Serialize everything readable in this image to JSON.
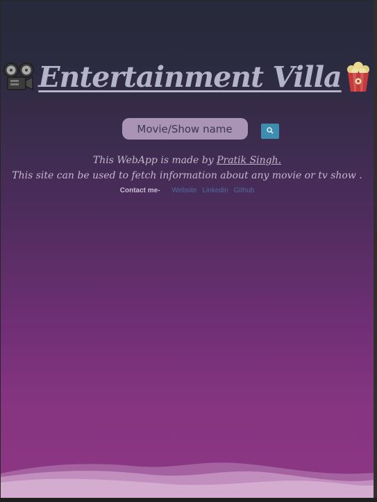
{
  "header": {
    "title": "Entertainment Villa",
    "left_icon": "film-projector-icon",
    "right_icon": "popcorn-icon"
  },
  "search": {
    "placeholder": "Movie/Show name",
    "button_icon": "search-icon"
  },
  "credit": {
    "prefix": "This WebApp is made by ",
    "author": "Pratik Singh.",
    "line2": "This site can be used to fetch information about any movie or tv show ."
  },
  "contact": {
    "label": "Contact me-",
    "links": [
      "Website",
      "Linkedin",
      "Github"
    ]
  },
  "colors": {
    "background_top": "#272a3b",
    "background_bottom": "#8c3683",
    "title": "#b3b3c9",
    "search_field": "#a994b5",
    "search_button": "#3e8db0",
    "link": "#4f6da0",
    "wave": "#c89ac4"
  }
}
